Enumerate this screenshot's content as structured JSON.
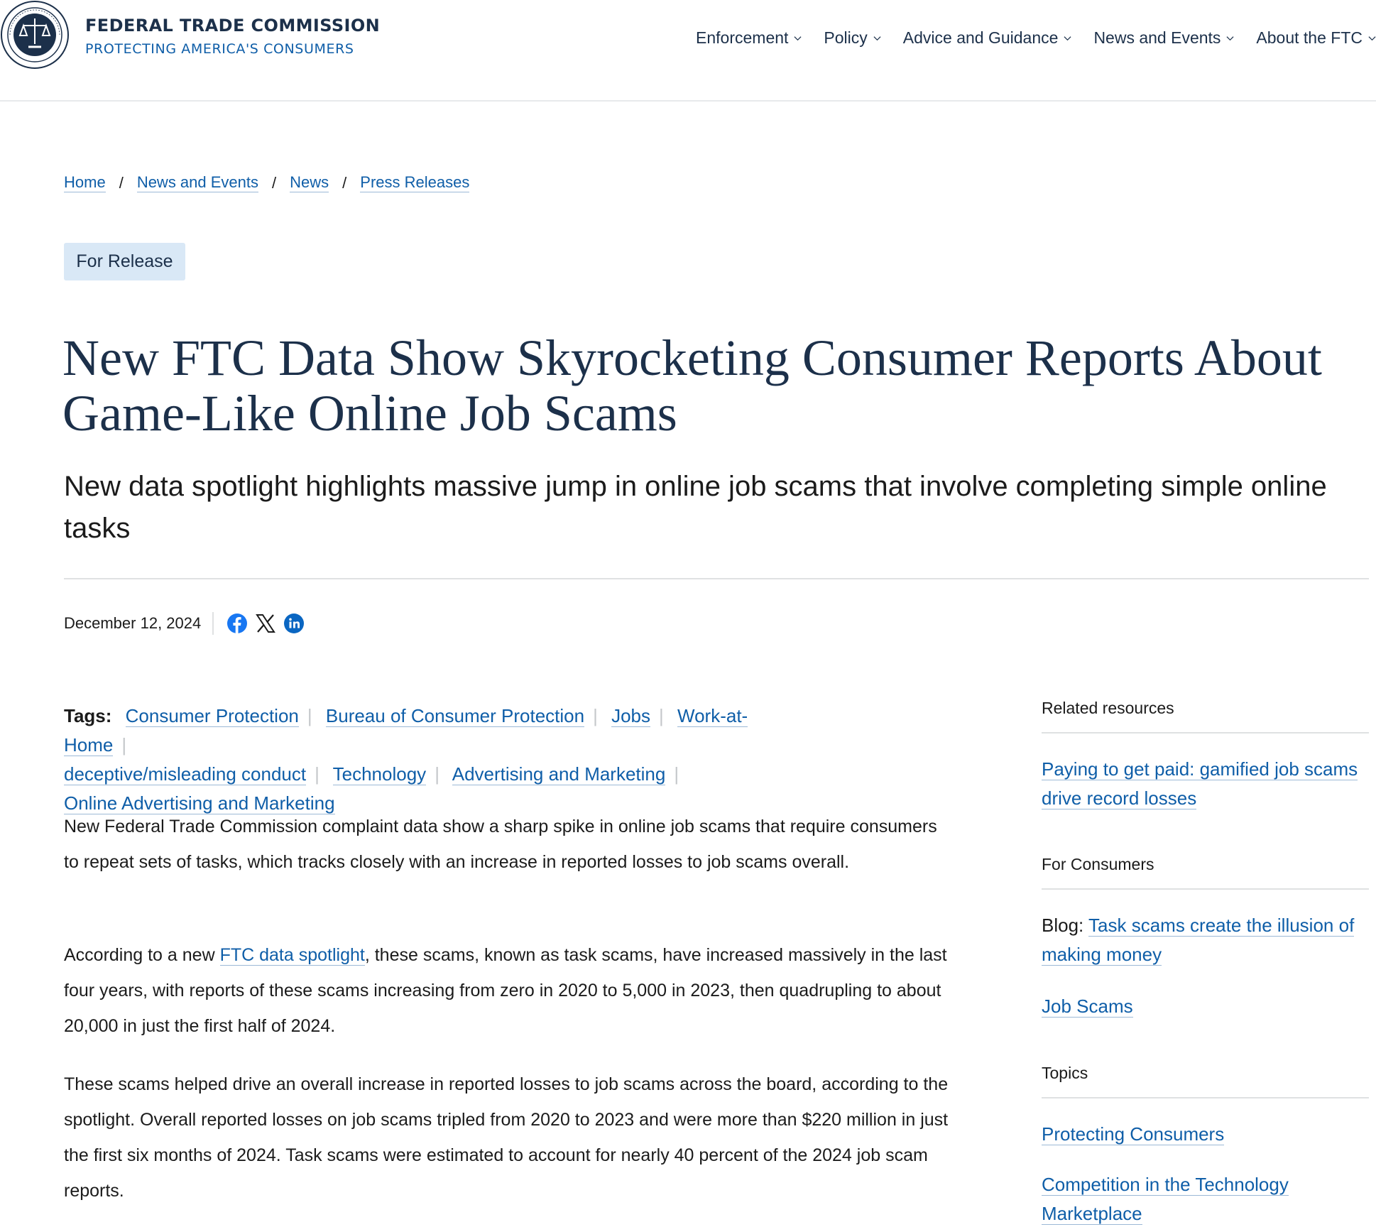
{
  "header": {
    "title": "FEDERAL TRADE COMMISSION",
    "subtitle": "PROTECTING AMERICA'S CONSUMERS",
    "nav": [
      {
        "label": "Enforcement"
      },
      {
        "label": "Policy"
      },
      {
        "label": "Advice and Guidance"
      },
      {
        "label": "News and Events"
      },
      {
        "label": "About the FTC"
      }
    ]
  },
  "breadcrumb": [
    "Home",
    "News and Events",
    "News",
    "Press Releases"
  ],
  "release_tag": "For Release",
  "headline": "New FTC Data Show Skyrocketing Consumer Reports About Game-Like Online Job Scams",
  "subhead": "New data spotlight highlights massive jump in online job scams that involve completing simple online tasks",
  "date": "December 12, 2024",
  "social": [
    "facebook-icon",
    "x-icon",
    "linkedin-icon"
  ],
  "tags": {
    "label": "Tags:",
    "items": [
      "Consumer Protection",
      "Bureau of Consumer Protection",
      "Jobs",
      "Work-at-Home",
      "deceptive/misleading conduct",
      "Technology",
      "Advertising and Marketing",
      "Online Advertising and Marketing"
    ]
  },
  "body": {
    "p1": "New Federal Trade Commission complaint data show a sharp spike in online job scams that require consumers to repeat sets of tasks, which tracks closely with an increase in reported losses to job scams overall.",
    "p2_before": "According to a new ",
    "p2_link": "FTC data spotlight",
    "p2_after": ", these scams, known as task scams, have increased massively in the last four years, with reports of these scams increasing from zero in 2020 to 5,000 in 2023, then quadrupling to about 20,000 in just the first half of 2024.",
    "p3": "These scams helped drive an overall increase in reported losses to job scams across the board, according to the spotlight. Overall reported losses on job scams tripled from 2020 to 2023 and were more than $220 million in just the first six months of 2024. Task scams were estimated to account for nearly 40 percent of the 2024 job scam reports."
  },
  "sidebar": {
    "related_heading": "Related resources",
    "related_link": "Paying to get paid: gamified job scams drive record losses",
    "consumers_heading": "For Consumers",
    "blog_prefix": "Blog: ",
    "blog_link": "Task scams create the illusion of making money",
    "job_scams_link": "Job Scams",
    "topics_heading": "Topics",
    "topic_links": [
      "Protecting Consumers",
      "Competition in the Technology Marketplace"
    ]
  }
}
